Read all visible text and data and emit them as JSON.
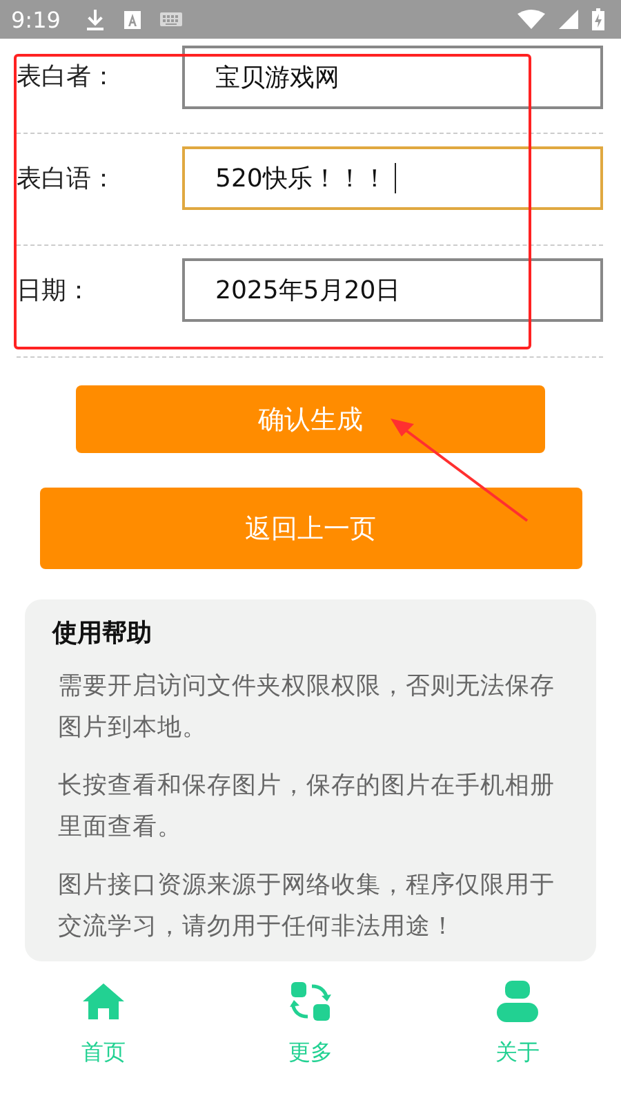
{
  "status_bar": {
    "time": "9:19"
  },
  "form": {
    "fields": [
      {
        "label": "表白者：",
        "value": "宝贝游戏网",
        "focused": false
      },
      {
        "label": "表白语：",
        "value": "520快乐！！！",
        "focused": true
      },
      {
        "label": "日期：",
        "value": "2025年5月20日",
        "focused": false
      }
    ]
  },
  "buttons": [
    {
      "label": "确认生成",
      "kind": "narrow"
    },
    {
      "label": "返回上一页",
      "kind": "wide"
    }
  ],
  "help": {
    "title": "使用帮助",
    "paragraphs": [
      "需要开启访问文件夹权限权限，否则无法保存图片到本地。",
      "长按查看和保存图片，保存的图片在手机相册里面查看。",
      "图片接口资源来源于网络收集，程序仅限用于交流学习，请勿用于任何非法用途！"
    ]
  },
  "bottom_nav": [
    {
      "label": "首页"
    },
    {
      "label": "更多"
    },
    {
      "label": "关于"
    }
  ]
}
